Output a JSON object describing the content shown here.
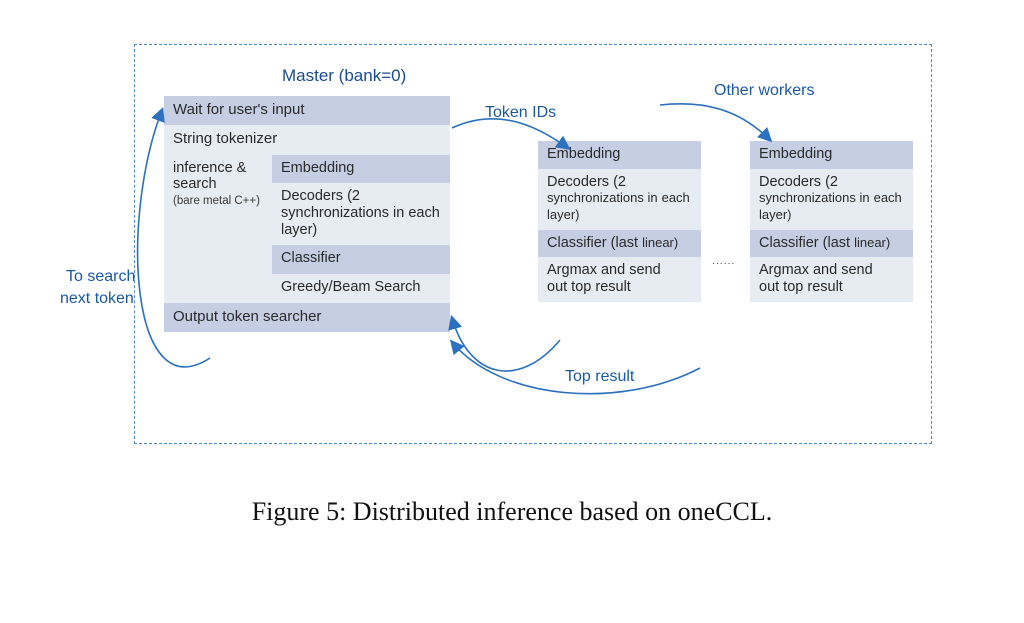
{
  "labels": {
    "master": "Master (bank=0)",
    "token_ids": "Token IDs",
    "other_workers": "Other workers",
    "top_result": "Top result",
    "to_search_line1": "To search",
    "to_search_line2": "next token",
    "dots": "······"
  },
  "master": {
    "wait": "Wait for user's input",
    "tokenizer": "String tokenizer",
    "inf_search_title": "inference & search",
    "inf_search_sub": "(bare metal C++)",
    "embedding": "Embedding",
    "decoders": "Decoders (2 synchronizations in each layer)",
    "classifier": "Classifier",
    "greedy": "Greedy/Beam Search",
    "output_searcher": "Output token searcher"
  },
  "worker": {
    "embedding": "Embedding",
    "decoders_a": "Decoders (2",
    "decoders_b": "synchronizations in",
    "decoders_c": "each layer)",
    "classifier_a": "Classifier (last",
    "classifier_b": "linear)",
    "argmax_a": "Argmax and send",
    "argmax_b": "out top result"
  },
  "caption": "Figure 5: Distributed inference based on oneCCL."
}
